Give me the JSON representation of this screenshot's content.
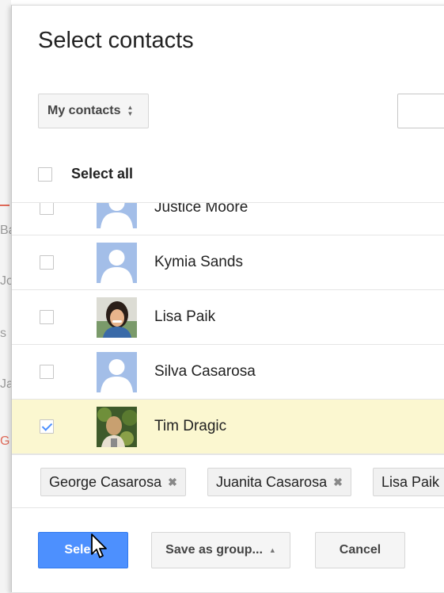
{
  "background": {
    "fragments": [
      "Ba",
      "Jo",
      "s",
      "Ja",
      "G"
    ]
  },
  "dialog": {
    "title": "Select contacts",
    "group_select": {
      "value": "My contacts"
    },
    "search": {
      "value": ""
    },
    "select_all_label": "Select all",
    "contacts": [
      {
        "name": "Justice Moore",
        "checked": false,
        "avatar": "default-avatar-icon"
      },
      {
        "name": "Kymia Sands",
        "checked": false,
        "avatar": "default-avatar-icon"
      },
      {
        "name": "Lisa Paik",
        "checked": false,
        "avatar": "photo"
      },
      {
        "name": "Silva Casarosa",
        "checked": false,
        "avatar": "default-avatar-icon"
      },
      {
        "name": "Tim Dragic",
        "checked": true,
        "avatar": "photo"
      }
    ],
    "selected_chips": [
      "George Casarosa",
      "Juanita Casarosa",
      "Lisa Paik"
    ],
    "buttons": {
      "select": "Select",
      "save_as_group": "Save as group...",
      "cancel": "Cancel"
    }
  },
  "colors": {
    "accent": "#4d90fe",
    "selected_row": "#fbf7d0",
    "avatar_placeholder": "#a3bee8"
  }
}
